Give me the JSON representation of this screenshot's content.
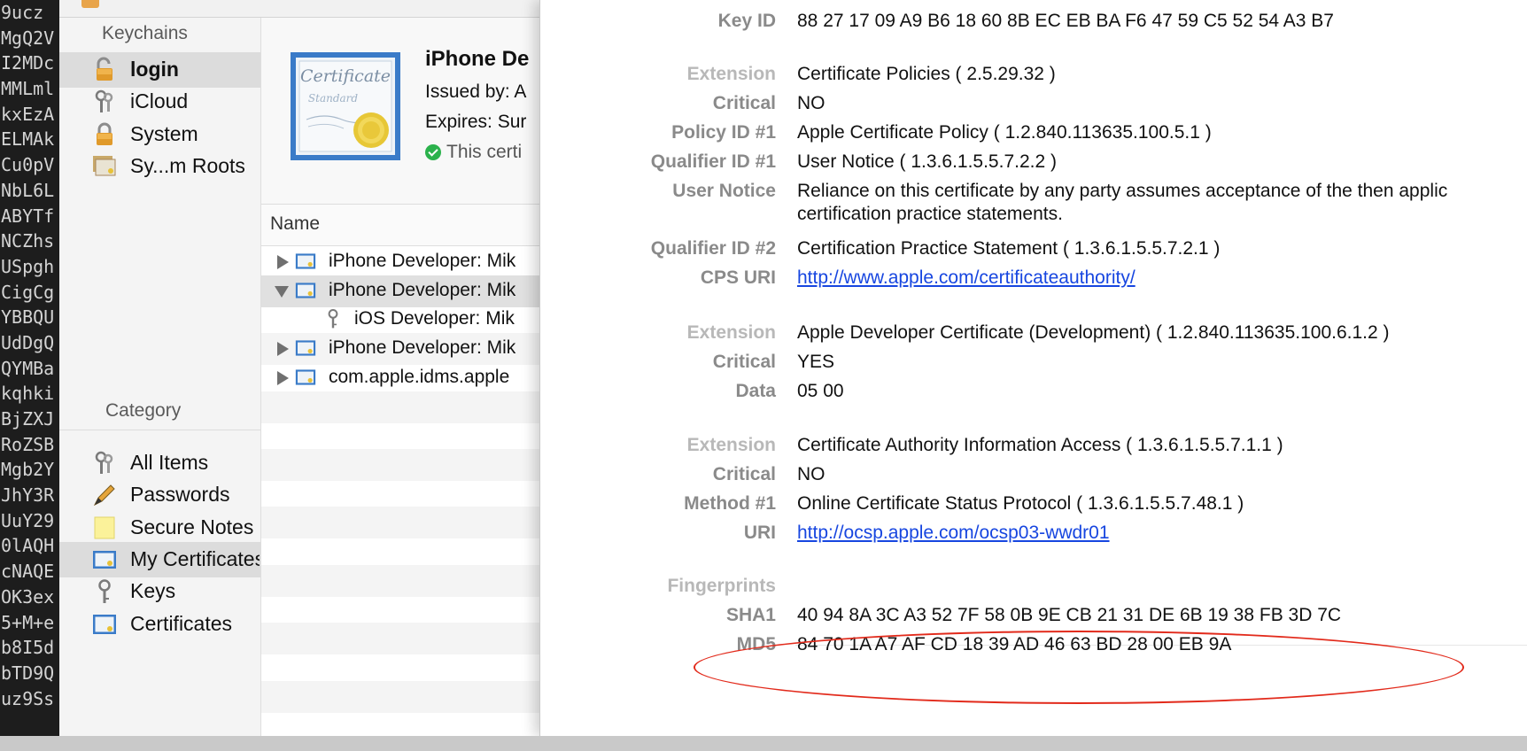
{
  "terminal": {
    "lines": [
      "9ucz",
      "MgQ2V",
      "I2MDc",
      "MMLml",
      "kxEzA",
      "ELMAk",
      "Cu0pV",
      "NbL6L",
      "ABYTf",
      "NCZhs",
      "USpgh",
      "CigCg",
      "YBBQU",
      "UdDgQ",
      "QYMBa",
      "kqhki",
      "BjZXJ",
      "RoZSB",
      "Mgb2Y",
      "JhY3R",
      "UuY29",
      "0lAQH",
      "cNAQE",
      "OK3ex",
      "5+M+e",
      "b8I5d",
      "bTD9Q",
      "uz9Ss"
    ]
  },
  "sidebar": {
    "keychains_header": "Keychains",
    "keychains": [
      {
        "label": "login",
        "icon": "unlocked-padlock-icon",
        "selected": true,
        "bold": true
      },
      {
        "label": "iCloud",
        "icon": "keys-icon",
        "selected": false,
        "bold": false
      },
      {
        "label": "System",
        "icon": "padlock-icon",
        "selected": false,
        "bold": false
      },
      {
        "label": "Sy...m Roots",
        "icon": "certificate-stack-icon",
        "selected": false,
        "bold": false
      }
    ],
    "category_header": "Category",
    "categories": [
      {
        "label": "All Items",
        "icon": "keys-icon",
        "selected": false
      },
      {
        "label": "Passwords",
        "icon": "pencil-icon",
        "selected": false
      },
      {
        "label": "Secure Notes",
        "icon": "note-icon",
        "selected": false
      },
      {
        "label": "My Certificates",
        "icon": "certificate-icon",
        "selected": true
      },
      {
        "label": "Keys",
        "icon": "key-icon",
        "selected": false
      },
      {
        "label": "Certificates",
        "icon": "certificate-blue-icon",
        "selected": false
      }
    ]
  },
  "certificate_header": {
    "title": "iPhone De",
    "issued_by": "Issued by: A",
    "expires": "Expires: Sur",
    "status": "This certi",
    "icon_text_top": "Certificate",
    "icon_text_bottom": "Standard"
  },
  "list": {
    "column_name": "Name",
    "rows": [
      {
        "label": "iPhone Developer: Mik",
        "disclosure": "collapsed",
        "icon": "certificate-icon",
        "indent": 0,
        "selected": false
      },
      {
        "label": "iPhone Developer: Mik",
        "disclosure": "expanded",
        "icon": "certificate-icon",
        "indent": 0,
        "selected": true
      },
      {
        "label": "iOS Developer: Mik",
        "disclosure": "none",
        "icon": "key-icon",
        "indent": 1,
        "selected": false
      },
      {
        "label": "iPhone Developer: Mik",
        "disclosure": "collapsed",
        "icon": "certificate-icon",
        "indent": 0,
        "selected": false
      },
      {
        "label": "com.apple.idms.apple",
        "disclosure": "collapsed",
        "icon": "certificate-icon",
        "indent": 0,
        "selected": false
      }
    ]
  },
  "details": {
    "rows": [
      {
        "label": "Key ID",
        "value": "88 27 17 09 A9 B6 18 60 8B EC EB BA F6 47 59 C5 52 54 A3 B7"
      },
      {
        "label": "Extension",
        "value": "Certificate Policies ( 2.5.29.32 )",
        "dim": true
      },
      {
        "label": "Critical",
        "value": "NO"
      },
      {
        "label": "Policy ID #1",
        "value": "Apple Certificate Policy ( 1.2.840.113635.100.5.1 )"
      },
      {
        "label": "Qualifier ID #1",
        "value": "User Notice ( 1.3.6.1.5.5.7.2.2 )"
      },
      {
        "label": "User Notice",
        "value": "Reliance on this certificate by any party assumes acceptance of the then applic",
        "value2": "certification practice statements."
      },
      {
        "label": "Qualifier ID #2",
        "value": "Certification Practice Statement ( 1.3.6.1.5.5.7.2.1 )"
      },
      {
        "label": "CPS URI",
        "value": "http://www.apple.com/certificateauthority/",
        "link": true
      },
      {
        "label": "Extension",
        "value": "Apple Developer Certificate (Development) ( 1.2.840.113635.100.6.1.2 )",
        "dim": true
      },
      {
        "label": "Critical",
        "value": "YES"
      },
      {
        "label": "Data",
        "value": "05 00"
      },
      {
        "label": "Extension",
        "value": "Certificate Authority Information Access ( 1.3.6.1.5.5.7.1.1 )",
        "dim": true
      },
      {
        "label": "Critical",
        "value": "NO"
      },
      {
        "label": "Method #1",
        "value": "Online Certificate Status Protocol ( 1.3.6.1.5.5.7.48.1 )"
      },
      {
        "label": "URI",
        "value": "http://ocsp.apple.com/ocsp03-wwdr01",
        "link": true
      }
    ],
    "fingerprints_label": "Fingerprints",
    "sha1_label": "SHA1",
    "sha1_value": "40 94 8A 3C A3 52 7F 58 0B 9E CB 21 31 DE 6B 19 38 FB 3D 7C",
    "md5_label": "MD5",
    "md5_value": "84 70 1A A7 AF CD 18 39 AD 46 63 BD 28 00 EB 9A"
  },
  "colors": {
    "link": "#1746e0",
    "annotation": "#e22a1b",
    "label": "#8a8a8a",
    "label_dim": "#b8b8b8"
  }
}
